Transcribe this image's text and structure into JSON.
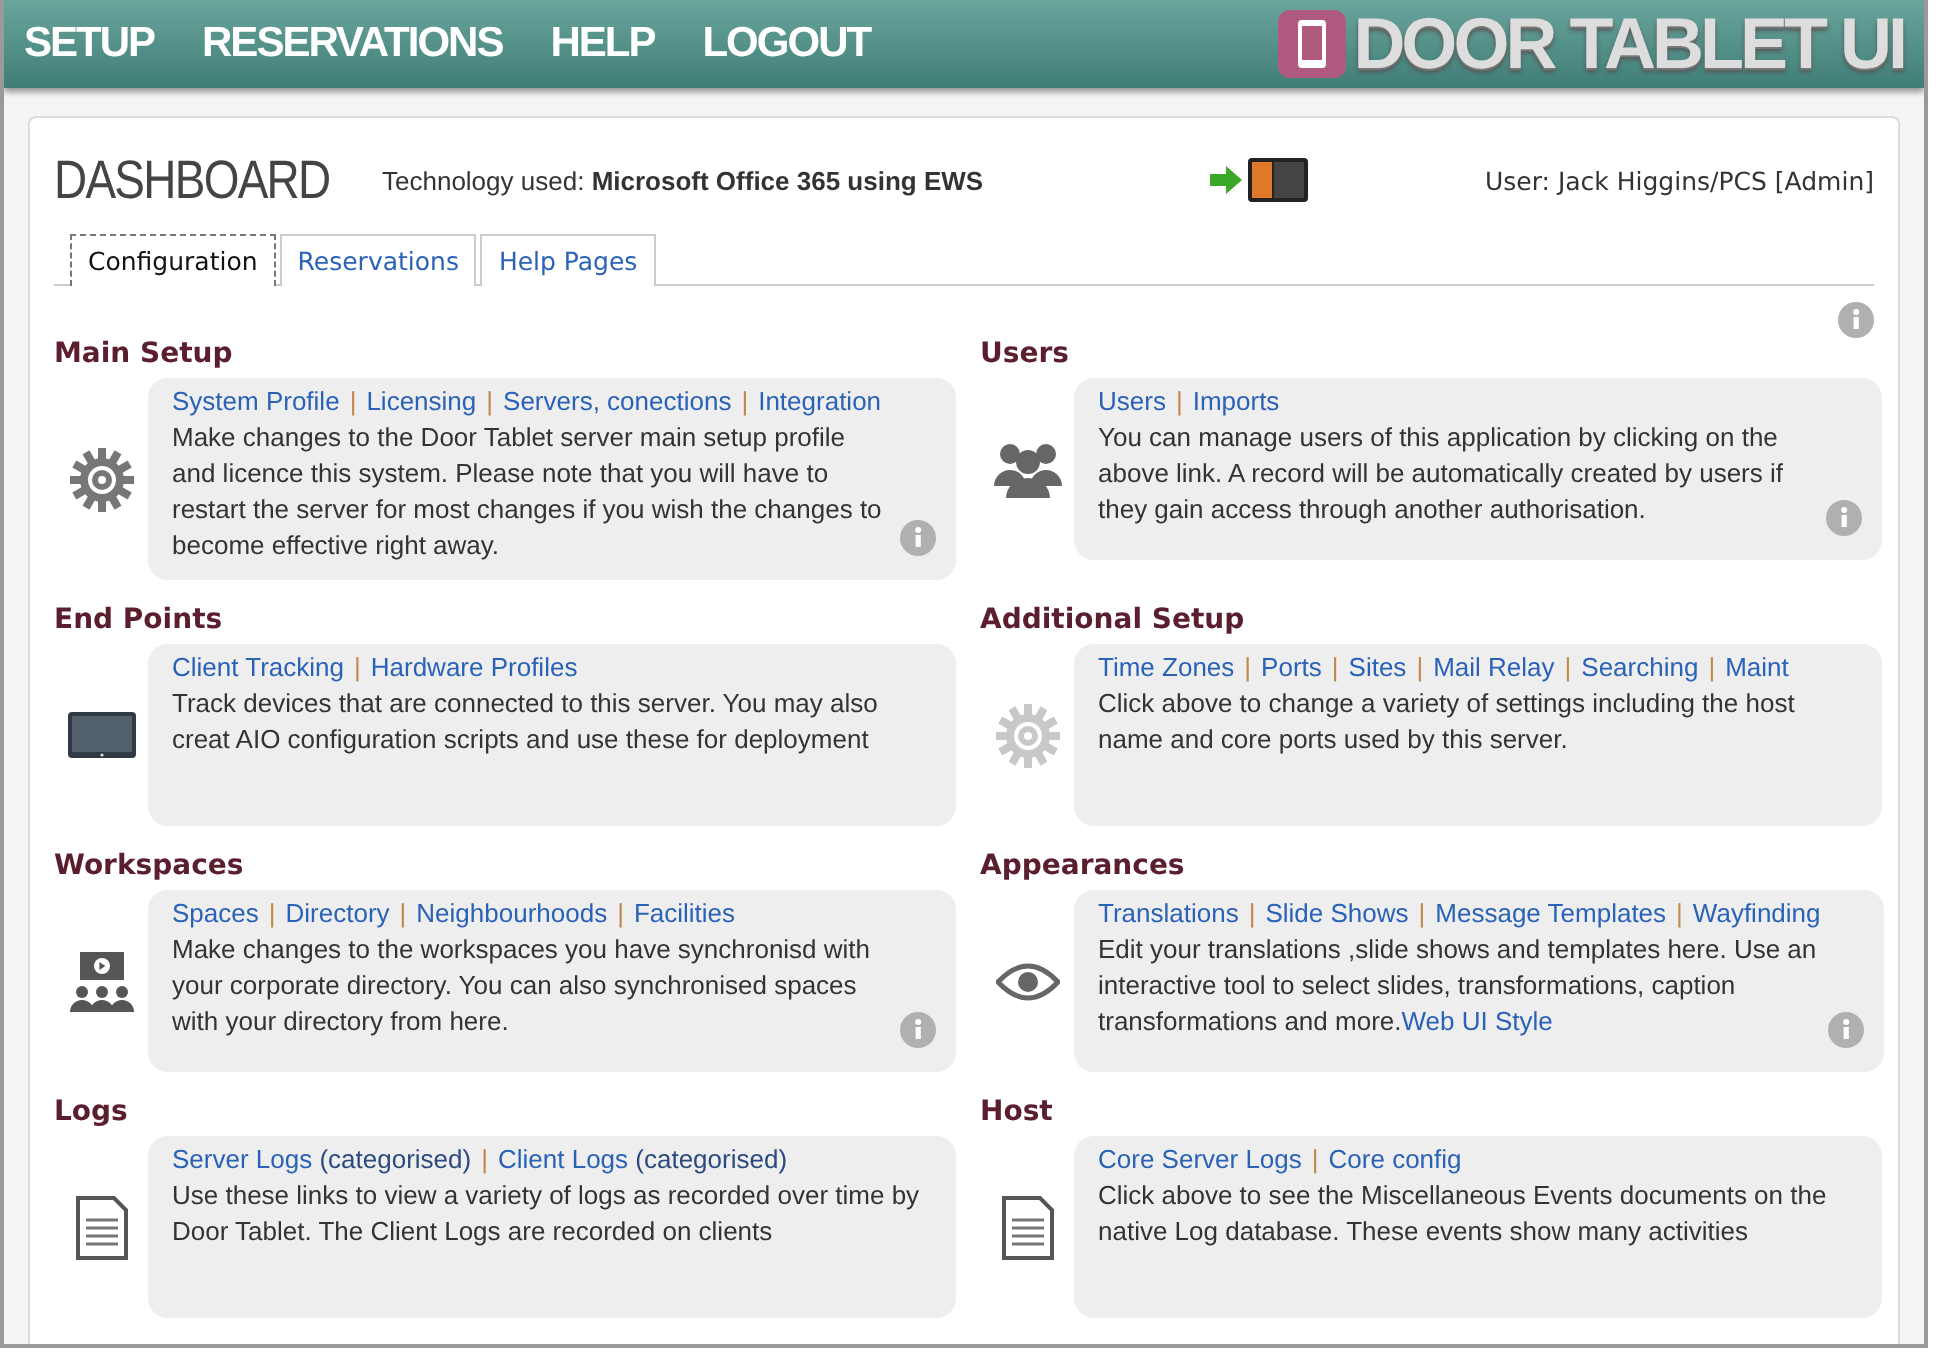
{
  "nav": {
    "items": [
      "SETUP",
      "RESERVATIONS",
      "HELP",
      "LOGOUT"
    ],
    "logo_text": "DOOR TABLET UI"
  },
  "dashboard": {
    "title": "DASHBOARD",
    "technology_label": "Technology used:",
    "technology": "Microsoft Office 365 using EWS",
    "user": "User: Jack Higgins/PCS [Admin]"
  },
  "tabs": [
    {
      "label": "Configuration",
      "selected": true
    },
    {
      "label": "Reservations",
      "selected": false
    },
    {
      "label": "Help Pages",
      "selected": false
    }
  ],
  "link_separator": "|",
  "sections": [
    {
      "title": "Main Setup",
      "kind": "gear",
      "info": true,
      "links": [
        {
          "text": "System Profile"
        },
        {
          "text": "Licensing"
        },
        {
          "text": "Servers, conections"
        },
        {
          "text": "Integration"
        }
      ],
      "description": "Make changes to the Door Tablet server main setup profile and licence this system. Please note that you will have to restart the server for most changes if you wish the changes to become effective right away."
    },
    {
      "title": "Users",
      "kind": "users",
      "info": true,
      "links": [
        {
          "text": "Users"
        },
        {
          "text": "Imports"
        }
      ],
      "description": "You can manage users of this application by clicking on the above link. A record will be automatically created by users if they gain access through another authorisation."
    },
    {
      "title": "End Points",
      "kind": "tablet",
      "info": false,
      "links": [
        {
          "text": "Client Tracking"
        },
        {
          "text": "Hardware Profiles"
        }
      ],
      "description": "Track devices that are connected to this server.  You may also creat AIO configuration scripts and use these for deployment"
    },
    {
      "title": "Additional Setup",
      "kind": "gearlight",
      "info": false,
      "links": [
        {
          "text": "Time Zones"
        },
        {
          "text": "Ports"
        },
        {
          "text": "Sites"
        },
        {
          "text": "Mail Relay"
        },
        {
          "text": "Searching"
        },
        {
          "text": "Maint"
        }
      ],
      "description": "Click above to change a variety of settings including the host name and core ports used by this server."
    },
    {
      "title": "Workspaces",
      "kind": "workspace",
      "info": true,
      "links": [
        {
          "text": "Spaces"
        },
        {
          "text": "Directory"
        },
        {
          "text": "Neighbourhoods"
        },
        {
          "text": "Facilities"
        }
      ],
      "description": "Make changes to the workspaces you have synchronisd with your corporate directory. You can also synchronised spaces with your directory from here."
    },
    {
      "title": "Appearances",
      "kind": "eye",
      "info": true,
      "links": [
        {
          "text": "Translations"
        },
        {
          "text": "Slide Shows"
        },
        {
          "text": "Message Templates"
        },
        {
          "text": "Wayfinding"
        }
      ],
      "description": "Edit your translations ,slide shows and templates here. Use an interactive tool to select slides, transformations, caption transformations and more.",
      "trailing_link": "Web UI Style"
    },
    {
      "title": "Logs",
      "kind": "document",
      "info": false,
      "links": [
        {
          "text": "Server Logs",
          "note": "(categorised)"
        },
        {
          "text": "Client Logs",
          "note": "(categorised)"
        }
      ],
      "description": "Use these links to view a variety of logs as recorded over time by Door Tablet. The Client Logs are recorded on clients"
    },
    {
      "title": "Host",
      "kind": "document",
      "info": false,
      "links": [
        {
          "text": "Core Server Logs"
        },
        {
          "text": "Core config"
        }
      ],
      "description": "Click above to see the Miscellaneous Events documents on the native Log database. These events show many activities"
    }
  ]
}
